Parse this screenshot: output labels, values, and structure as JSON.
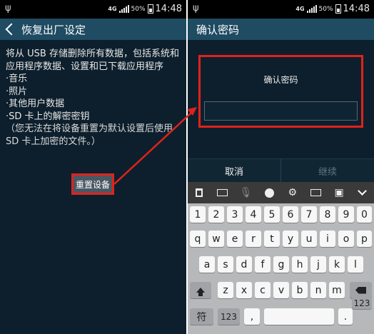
{
  "status_bar": {
    "network": "4G",
    "battery": "50%",
    "time": "14:48"
  },
  "left_screen": {
    "title": "恢复出厂设定",
    "intro": "将从 USB 存储删除所有数据，包括系统和应用程序数据、设置和已下载应用程序",
    "items": [
      "·音乐",
      "·照片",
      "·其他用户数据",
      "·SD 卡上的解密密钥"
    ],
    "note": "（您无法在将设备重置为默认设置后使用 SD 卡上加密的文件。）",
    "reset_button": "重置设备"
  },
  "right_screen": {
    "title": "确认密码",
    "dialog_label": "确认密码",
    "password_value": "",
    "cancel": "取消",
    "continue": "继续"
  },
  "toolbar_icons": [
    "clipboard-icon",
    "keyboard-icon",
    "microphone-icon",
    "emoji-icon",
    "settings-icon",
    "handwriting-icon",
    "window-icon",
    "collapse-icon"
  ],
  "keyboard": {
    "row1": [
      "1",
      "2",
      "3",
      "4",
      "5",
      "6",
      "7",
      "8",
      "9",
      "0"
    ],
    "row2": [
      "q",
      "w",
      "e",
      "r",
      "t",
      "y",
      "u",
      "i",
      "o",
      "p"
    ],
    "row3": [
      "a",
      "s",
      "d",
      "f",
      "g",
      "h",
      "j",
      "k",
      "l"
    ],
    "row4": [
      "z",
      "x",
      "c",
      "v",
      "b",
      "n",
      "m"
    ],
    "row5": [
      "符",
      "123",
      ",",
      "",
      ".",
      "123"
    ]
  },
  "colors": {
    "highlight": "#e0221c",
    "actionbar": "#1f4b63",
    "background": "#0d1f2c"
  }
}
